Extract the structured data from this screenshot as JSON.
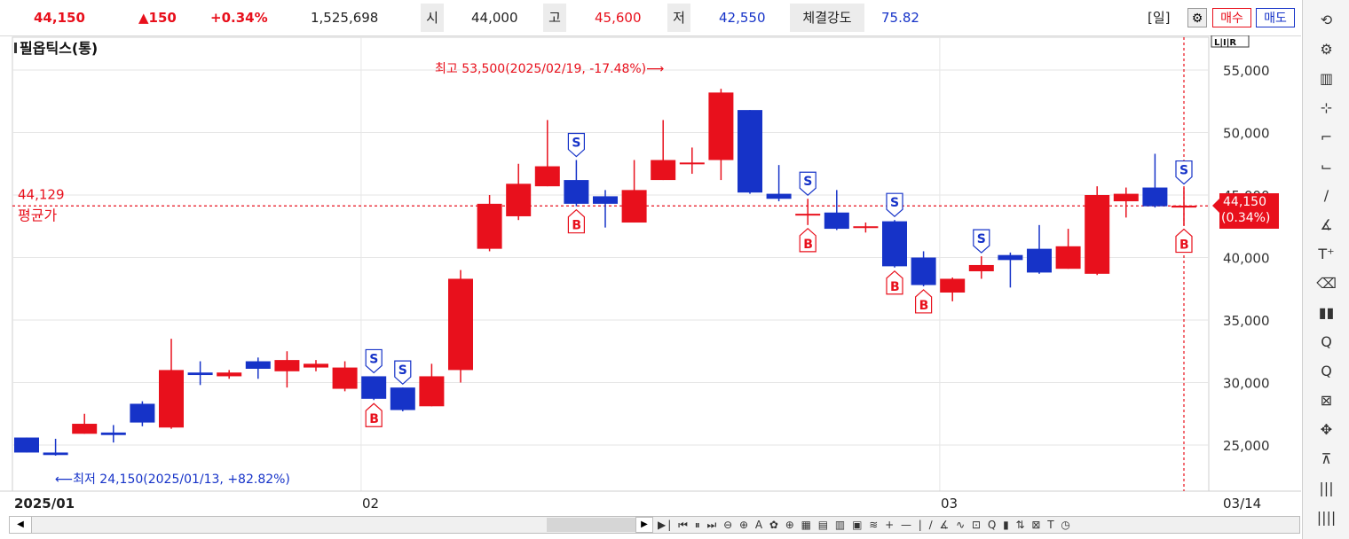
{
  "header": {
    "price": "44,150",
    "change": "▲150",
    "change_pct": "+0.34%",
    "volume": "1,525,698",
    "open_label": "시",
    "open": "44,000",
    "high_label": "고",
    "high": "45,600",
    "low_label": "저",
    "low": "42,550",
    "strength_label": "체결강도",
    "strength": "75.82",
    "period": "[일]",
    "buy_label": "매수",
    "sell_label": "매도"
  },
  "colors": {
    "up": "#e8101c",
    "down": "#1633c8",
    "grid": "#e6e6e6",
    "avg": "#e8101c"
  },
  "icons": [
    "refresh-icon",
    "gear-icon",
    "chart-icon",
    "crosshair-icon",
    "trend-icon",
    "arrow-icon",
    "line-icon",
    "auto-icon",
    "text-icon",
    "eraser-icon",
    "candle-icon",
    "zoom-in-icon",
    "zoom-out-icon",
    "zoom-select-icon",
    "pan-icon",
    "grid-icon",
    "bars-icon",
    "bars2-icon"
  ],
  "chart_data": {
    "type": "candlestick",
    "title": "필옵틱스(통)",
    "y_ticks": [
      25000,
      30000,
      35000,
      40000,
      45000,
      50000,
      55000
    ],
    "y_tick_labels": [
      "25,000",
      "30,000",
      "35,000",
      "40,000",
      "45,000",
      "50,000",
      "55,000"
    ],
    "ylim": [
      22000,
      57000
    ],
    "x_labels": [
      {
        "index": 0,
        "label": "2025/01",
        "bold": true
      },
      {
        "index": 12,
        "label": "02"
      },
      {
        "index": 32,
        "label": "03"
      },
      {
        "index": 41,
        "label": "03/14"
      }
    ],
    "candles": [
      {
        "o": 25600,
        "h": 25600,
        "l": 24400,
        "c": 24400
      },
      {
        "o": 24400,
        "h": 25500,
        "l": 24150,
        "c": 24200
      },
      {
        "o": 25900,
        "h": 27500,
        "l": 25900,
        "c": 26700
      },
      {
        "o": 26000,
        "h": 26600,
        "l": 25200,
        "c": 25800
      },
      {
        "o": 28300,
        "h": 28500,
        "l": 26500,
        "c": 26800
      },
      {
        "o": 26400,
        "h": 33500,
        "l": 26300,
        "c": 31000
      },
      {
        "o": 30800,
        "h": 31700,
        "l": 29800,
        "c": 30600
      },
      {
        "o": 30500,
        "h": 31000,
        "l": 30300,
        "c": 30800
      },
      {
        "o": 31700,
        "h": 32000,
        "l": 30300,
        "c": 31100
      },
      {
        "o": 30900,
        "h": 32500,
        "l": 29600,
        "c": 31800
      },
      {
        "o": 31200,
        "h": 31800,
        "l": 30900,
        "c": 31500
      },
      {
        "o": 29500,
        "h": 31700,
        "l": 29300,
        "c": 31200
      },
      {
        "o": 30500,
        "h": 30500,
        "l": 28600,
        "c": 28700
      },
      {
        "o": 29600,
        "h": 29600,
        "l": 27700,
        "c": 27800
      },
      {
        "o": 28100,
        "h": 31500,
        "l": 28100,
        "c": 30500
      },
      {
        "o": 31000,
        "h": 39000,
        "l": 30000,
        "c": 38300
      },
      {
        "o": 40700,
        "h": 45000,
        "l": 40500,
        "c": 44300
      },
      {
        "o": 43300,
        "h": 47500,
        "l": 43000,
        "c": 45900
      },
      {
        "o": 45700,
        "h": 51000,
        "l": 45700,
        "c": 47300
      },
      {
        "o": 46200,
        "h": 47800,
        "l": 44100,
        "c": 44300
      },
      {
        "o": 44900,
        "h": 45400,
        "l": 42400,
        "c": 44300
      },
      {
        "o": 42800,
        "h": 47800,
        "l": 42800,
        "c": 45400
      },
      {
        "o": 46200,
        "h": 51000,
        "l": 46200,
        "c": 47800
      },
      {
        "o": 47500,
        "h": 48800,
        "l": 46700,
        "c": 47600
      },
      {
        "o": 47800,
        "h": 53500,
        "l": 46200,
        "c": 53200
      },
      {
        "o": 51800,
        "h": 51800,
        "l": 45100,
        "c": 45200
      },
      {
        "o": 45100,
        "h": 47400,
        "l": 44500,
        "c": 44700
      },
      {
        "o": 43400,
        "h": 44700,
        "l": 42600,
        "c": 43500
      },
      {
        "o": 43600,
        "h": 45400,
        "l": 42200,
        "c": 42300
      },
      {
        "o": 42400,
        "h": 42800,
        "l": 42000,
        "c": 42500
      },
      {
        "o": 42900,
        "h": 43000,
        "l": 39200,
        "c": 39300
      },
      {
        "o": 40000,
        "h": 40500,
        "l": 37700,
        "c": 37800
      },
      {
        "o": 37200,
        "h": 38400,
        "l": 36500,
        "c": 38300
      },
      {
        "o": 38900,
        "h": 40100,
        "l": 38300,
        "c": 39400
      },
      {
        "o": 40200,
        "h": 40400,
        "l": 37600,
        "c": 39800
      },
      {
        "o": 40700,
        "h": 42600,
        "l": 38700,
        "c": 38800
      },
      {
        "o": 39100,
        "h": 42300,
        "l": 39100,
        "c": 40900
      },
      {
        "o": 38700,
        "h": 45700,
        "l": 38600,
        "c": 45000
      },
      {
        "o": 44500,
        "h": 45600,
        "l": 43200,
        "c": 45100
      },
      {
        "o": 45600,
        "h": 48300,
        "l": 44000,
        "c": 44100
      },
      {
        "o": 44000,
        "h": 45600,
        "l": 42550,
        "c": 44150
      }
    ],
    "signals": [
      {
        "index": 12,
        "type": "S",
        "pos": "top"
      },
      {
        "index": 12,
        "type": "B",
        "pos": "bottom"
      },
      {
        "index": 13,
        "type": "S",
        "pos": "top"
      },
      {
        "index": 19,
        "type": "S",
        "pos": "top"
      },
      {
        "index": 19,
        "type": "B",
        "pos": "bottom"
      },
      {
        "index": 27,
        "type": "S",
        "pos": "top"
      },
      {
        "index": 27,
        "type": "B",
        "pos": "bottom"
      },
      {
        "index": 30,
        "type": "S",
        "pos": "top"
      },
      {
        "index": 30,
        "type": "B",
        "pos": "bottom"
      },
      {
        "index": 31,
        "type": "B",
        "pos": "bottom"
      },
      {
        "index": 33,
        "type": "S",
        "pos": "top"
      },
      {
        "index": 40,
        "type": "S",
        "pos": "top"
      },
      {
        "index": 40,
        "type": "B",
        "pos": "bottom"
      }
    ],
    "avg_price": 44129,
    "avg_label": "44,129",
    "avg_title": "평균가",
    "current_price_label": "44,150",
    "current_pct_label": "(0.34%)",
    "high_annotation": "최고 53,500(2025/02/19, -17.48%)⟶",
    "low_annotation": "⟵최저 24,150(2025/01/13, +82.82%)"
  },
  "scroll_tools": "▶|  ⏮ ⏸ ⏭  ⊖ ⊕ A ✿ ⊕ ▦ ▤ ▥ ▣ ≋ + — | ∕ ∡ ∿ ⊡ Q ▮ ⇅ ⊠ T ◷"
}
